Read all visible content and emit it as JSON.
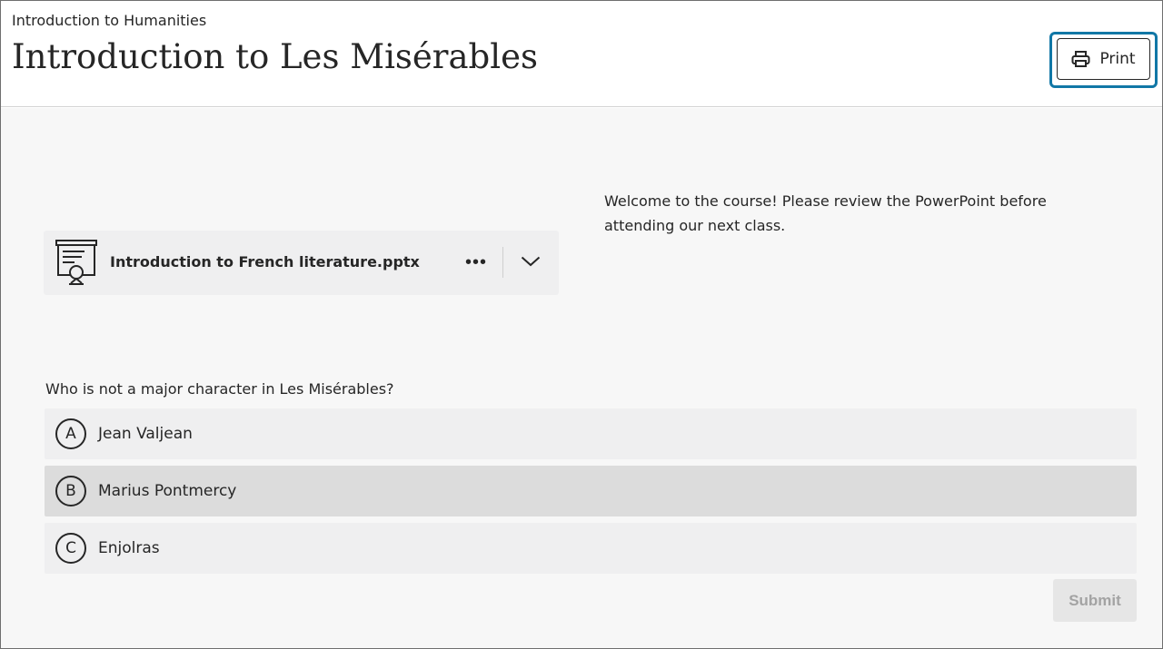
{
  "header": {
    "breadcrumb": "Introduction to Humanities",
    "title": "Introduction to Les Misérables",
    "print_label": "Print",
    "print_icon": "printer-icon"
  },
  "attachment": {
    "icon": "presentation-icon",
    "file_name": "Introduction to French literature.pptx",
    "more_icon": "ellipsis-icon",
    "more_label": "•••",
    "expand_icon": "chevron-down-icon"
  },
  "welcome_text": "Welcome to the course! Please review the PowerPoint before attending our next class.",
  "quiz": {
    "question": "Who is not a major character in Les Misérables?",
    "options": [
      {
        "letter": "A",
        "label": "Jean Valjean"
      },
      {
        "letter": "B",
        "label": "Marius Pontmercy"
      },
      {
        "letter": "C",
        "label": "Enjolras"
      }
    ],
    "hovered_option": "B",
    "submit_label": "Submit"
  },
  "colors": {
    "focus_ring": "#1177a6",
    "text": "#262626",
    "option_bg": "#efeff0",
    "option_hover_bg": "#dcdcdc",
    "submit_disabled_bg": "#e6e6e6",
    "submit_disabled_text": "#a3a3a3"
  }
}
